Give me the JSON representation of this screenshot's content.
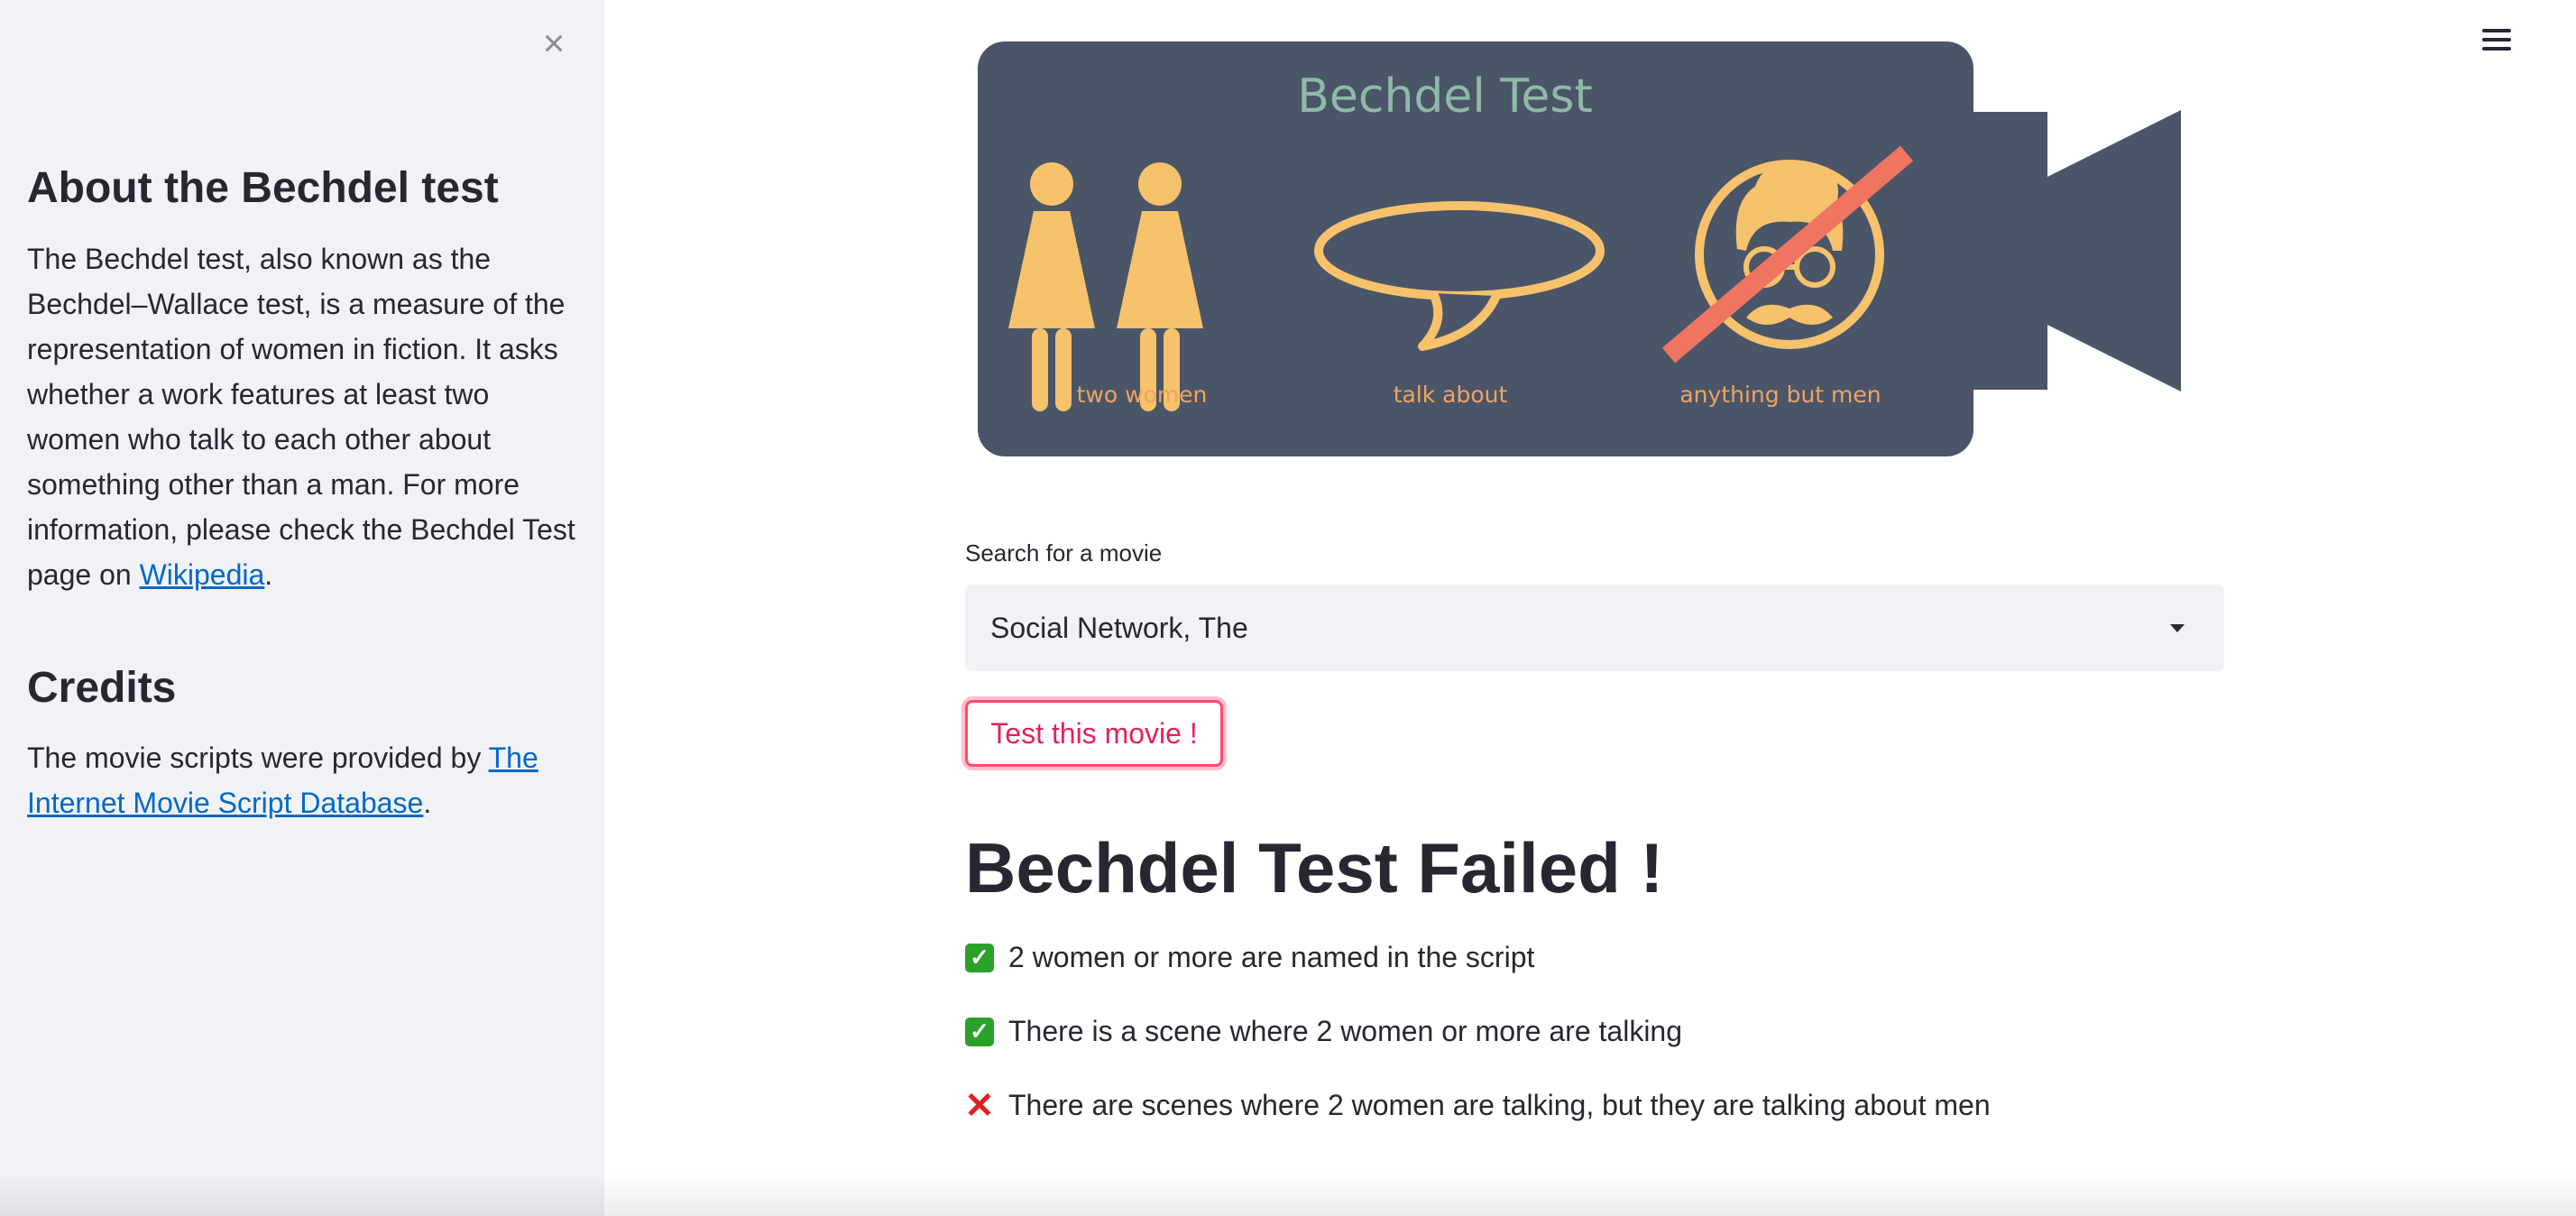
{
  "sidebar": {
    "close_label": "×",
    "about_heading": "About the Bechdel test",
    "about_text": "The Bechdel test, also known as the Bechdel–Wallace test, is a measure of the representation of women in fiction. It asks whether a work features at least two women who talk to each other about something other than a man. For more information, please check the Bechdel Test page on ",
    "about_link": "Wikipedia",
    "about_end": ".",
    "credits_heading": "Credits",
    "credits_text": "The movie scripts were provided by ",
    "credits_link": "The Internet Movie Script Database",
    "credits_end": "."
  },
  "banner": {
    "title": "Bechdel Test",
    "captions": [
      "two women",
      "talk about",
      "anything but men"
    ],
    "colors": {
      "camera": "#4a5568",
      "title": "#8fb9a8",
      "figure": "#f6c26b",
      "caption": "#f0a35e",
      "strike": "#f07561"
    }
  },
  "search": {
    "label": "Search for a movie",
    "selected": "Social Network, The"
  },
  "button": {
    "label": "Test this movie !"
  },
  "result": {
    "title": "Bechdel Test Failed !",
    "checks": [
      {
        "status": "pass",
        "icon": "check-mark-icon",
        "text": "2 women or more are named in the script"
      },
      {
        "status": "pass",
        "icon": "check-mark-icon",
        "text": "There is a scene where 2 women or more are talking"
      },
      {
        "status": "fail",
        "icon": "cross-mark-icon",
        "text": "There are scenes where 2 women are talking, but they are talking about men"
      }
    ]
  },
  "colors": {
    "sidebar_bg": "#f0f2f6",
    "link": "#0068c9",
    "accent": "#ff4b6e",
    "pass": "#2aa22a",
    "fail": "#e02020"
  }
}
